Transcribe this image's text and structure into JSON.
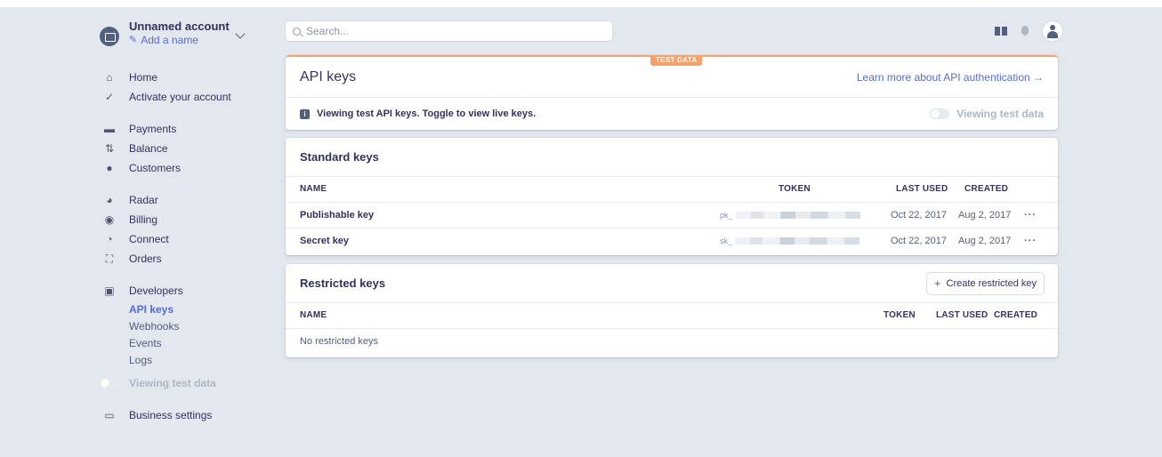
{
  "account": {
    "name": "Unnamed account",
    "add_name": "Add a name"
  },
  "search": {
    "placeholder": "Search..."
  },
  "sidebar": {
    "group1": [
      {
        "label": "Home",
        "icon": "home-icon"
      },
      {
        "label": "Activate your account",
        "icon": "check-icon"
      }
    ],
    "group2": [
      {
        "label": "Payments",
        "icon": "payments-icon"
      },
      {
        "label": "Balance",
        "icon": "balance-icon"
      },
      {
        "label": "Customers",
        "icon": "customers-icon"
      }
    ],
    "group3": [
      {
        "label": "Radar",
        "icon": "radar-icon"
      },
      {
        "label": "Billing",
        "icon": "billing-icon"
      },
      {
        "label": "Connect",
        "icon": "connect-icon"
      },
      {
        "label": "Orders",
        "icon": "orders-icon"
      }
    ],
    "developers": {
      "label": "Developers",
      "icon": "terminal-icon"
    },
    "dev_sub": [
      "API keys",
      "Webhooks",
      "Events",
      "Logs"
    ],
    "toggle_label": "Viewing test data",
    "business": {
      "label": "Business settings",
      "icon": "business-icon"
    }
  },
  "api_card": {
    "badge": "TEST DATA",
    "title": "API keys",
    "learn_link": "Learn more about API authentication →",
    "info_text": "Viewing test API keys. Toggle to view live keys.",
    "toggle_label": "Viewing test data"
  },
  "standard_keys": {
    "title": "Standard keys",
    "headers": {
      "name": "NAME",
      "token": "TOKEN",
      "last_used": "LAST USED",
      "created": "CREATED"
    },
    "rows": [
      {
        "name": "Publishable key",
        "token_prefix": "pk_",
        "last_used": "Oct 22, 2017",
        "created": "Aug 2, 2017",
        "menu": "···"
      },
      {
        "name": "Secret key",
        "token_prefix": "sk_",
        "last_used": "Oct 22, 2017",
        "created": "Aug 2, 2017",
        "menu": "···"
      }
    ]
  },
  "restricted_keys": {
    "title": "Restricted keys",
    "create_label": "Create restricted key",
    "headers": {
      "name": "NAME",
      "token": "TOKEN",
      "last_used": "LAST USED",
      "created": "CREATED"
    },
    "empty": "No restricted keys"
  },
  "colors": {
    "accent": "#556cd6",
    "test_badge": "#f5a16c",
    "background": "#e3e8ee"
  }
}
